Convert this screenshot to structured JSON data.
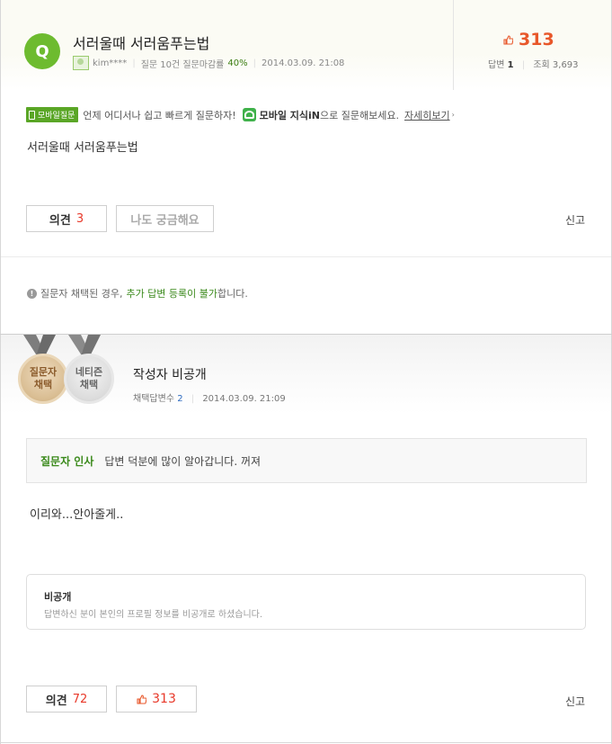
{
  "question": {
    "badge": "Q",
    "title": "서러울때 서러움푸는법",
    "author": "kim****",
    "stats_text": "질문 10건 질문마감률",
    "close_rate": "40%",
    "datetime": "2014.03.09. 21:08",
    "likes": "313",
    "answers_label": "답변",
    "answers_count": "1",
    "views_label": "조회",
    "views_count": "3,693",
    "body": "서러울때 서러움푸는법"
  },
  "mobile_notice": {
    "badge": "모바일질문",
    "text1": "언제 어디서나 쉽고 빠르게 질문하자!",
    "brand": "모바일 지식iN",
    "text2": "으로 질문해보세요.",
    "link": "자세히보기",
    "arrow": "›"
  },
  "question_actions": {
    "opinion_label": "의견",
    "opinion_count": "3",
    "curious_label": "나도 궁금해요",
    "report_label": "신고"
  },
  "notice": {
    "icon": "!",
    "pre": "질문자 채택된 경우,",
    "highlight": "추가 답변 등록이 불가",
    "post": "합니다."
  },
  "answer": {
    "medal1_line1": "질문자",
    "medal1_line2": "채택",
    "medal2_line1": "네티즌",
    "medal2_line2": "채택",
    "author": "작성자 비공개",
    "adopted_label": "채택답변수",
    "adopted_count": "2",
    "datetime": "2014.03.09. 21:09",
    "greeting_label": "질문자 인사",
    "greeting_text": "답변 덕분에 많이 알아갑니다. 꺼져",
    "body": "이리와...안아줄게..",
    "private_title": "비공개",
    "private_desc": "답변하신 분이 본인의 프로필 정보를 비공개로 하셨습니다."
  },
  "answer_actions": {
    "opinion_label": "의견",
    "opinion_count": "72",
    "like_count": "313",
    "report_label": "신고"
  },
  "colors": {
    "brand_green": "#6dbb2f",
    "like_orange": "#e8572a",
    "count_red": "#e8392a",
    "highlight_green": "#3b8a1c"
  }
}
